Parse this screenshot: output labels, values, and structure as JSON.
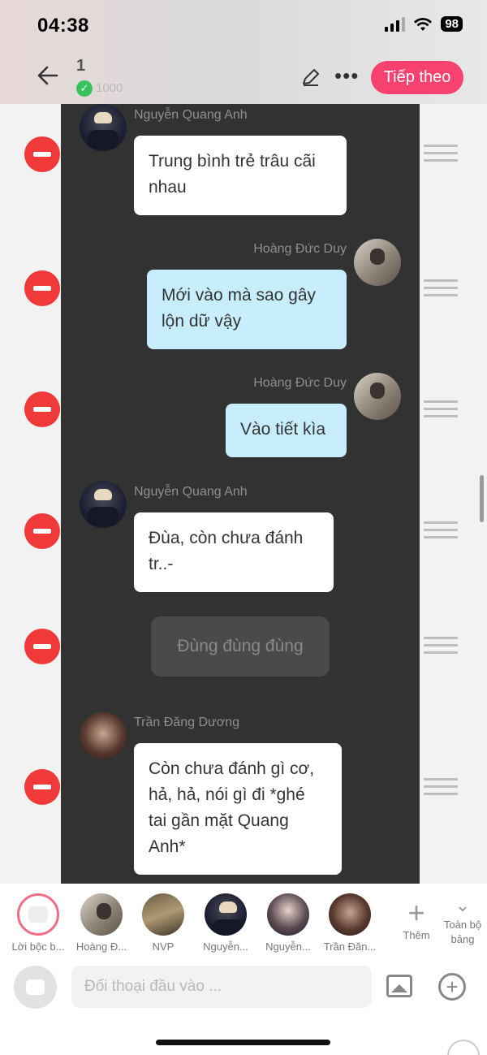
{
  "status": {
    "time": "04:38",
    "battery": "98"
  },
  "header": {
    "back_icon": "arrow-left-icon",
    "count": "1",
    "sub_count": "1000",
    "next_label": "Tiếp theo"
  },
  "messages": [
    {
      "sender": "Nguyễn Quang Anh",
      "text": "Trung bình trẻ trâu cãi nhau",
      "side": "left"
    },
    {
      "sender": "Hoàng Đức Duy",
      "text": "Mới vào mà sao gây lộn dữ vậy",
      "side": "right"
    },
    {
      "sender": "Hoàng Đức Duy",
      "text": "Vào tiết kìa",
      "side": "right"
    },
    {
      "sender": "Nguyễn Quang Anh",
      "text": "Đùa, còn chưa đánh tr..-",
      "side": "left"
    },
    {
      "sender": "",
      "text": "Đùng đùng đùng",
      "side": "narration"
    },
    {
      "sender": "Trần Đăng Dương",
      "text": "Còn chưa đánh gì cơ, hả, hả, nói gì đi *ghé tai gần mặt Quang Anh*",
      "side": "left"
    }
  ],
  "characters": [
    {
      "label": "Lời bộc b..."
    },
    {
      "label": "Hoàng Đ..."
    },
    {
      "label": "NVP"
    },
    {
      "label": "Nguyễn..."
    },
    {
      "label": "Nguyễn..."
    },
    {
      "label": "Trần Đăn..."
    }
  ],
  "add_label": "Thêm",
  "all_board_label": "Toàn bộ bảng",
  "input": {
    "placeholder": "Đối thoại đầu vào ..."
  },
  "colors": {
    "accent": "#f7416f",
    "bubble_blue": "#c8edfc",
    "delete_red": "#f03a3a",
    "chat_bg": "#323232"
  }
}
